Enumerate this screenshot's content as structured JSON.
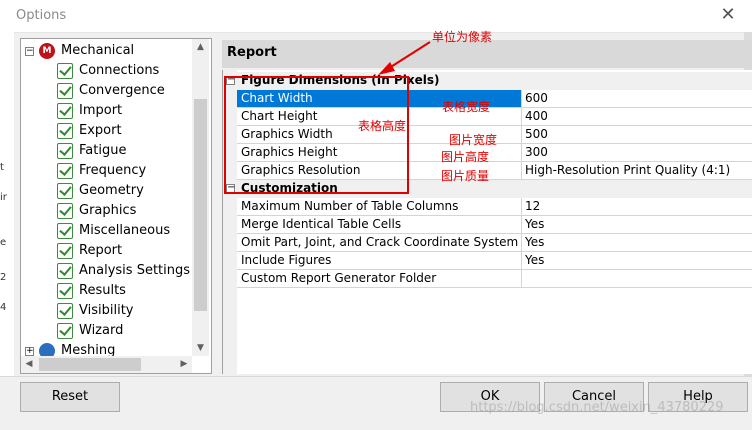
{
  "window": {
    "title": "Options",
    "close_glyph": "✕"
  },
  "tree": {
    "root": {
      "label": "Mechanical",
      "logo_letter": "M",
      "expander": "−"
    },
    "children": [
      {
        "label": "Connections"
      },
      {
        "label": "Convergence"
      },
      {
        "label": "Import"
      },
      {
        "label": "Export"
      },
      {
        "label": "Fatigue"
      },
      {
        "label": "Frequency"
      },
      {
        "label": "Geometry"
      },
      {
        "label": "Graphics"
      },
      {
        "label": "Miscellaneous"
      },
      {
        "label": "Report"
      },
      {
        "label": "Analysis Settings ar"
      },
      {
        "label": "Results"
      },
      {
        "label": "Visibility"
      },
      {
        "label": "Wizard"
      }
    ],
    "next_root": {
      "label": "Meshing",
      "expander": "+"
    }
  },
  "panel": {
    "title": "Report",
    "sections": [
      {
        "name": "Figure Dimensions (In Pixels)",
        "rows": [
          {
            "name": "Chart Width",
            "value": "600",
            "selected": true
          },
          {
            "name": "Chart Height",
            "value": "400"
          },
          {
            "name": "Graphics Width",
            "value": "500"
          },
          {
            "name": "Graphics Height",
            "value": "300"
          },
          {
            "name": "Graphics Resolution",
            "value": "High-Resolution Print Quality (4:1)"
          }
        ]
      },
      {
        "name": "Customization",
        "rows": [
          {
            "name": "Maximum Number of Table Columns",
            "value": "12"
          },
          {
            "name": "Merge Identical Table Cells",
            "value": "Yes"
          },
          {
            "name": "Omit Part, Joint, and Crack Coordinate System Tables",
            "value": "Yes"
          },
          {
            "name": "Include Figures",
            "value": "Yes"
          },
          {
            "name": "Custom Report Generator Folder",
            "value": ""
          }
        ]
      }
    ]
  },
  "annotations": {
    "unit_note": "单位为像素",
    "chart_width": "表格宽度",
    "chart_height": "表格高度",
    "graphics_width": "图片宽度",
    "graphics_height": "图片高度",
    "graphics_resolution": "图片质量"
  },
  "buttons": {
    "reset": "Reset",
    "ok": "OK",
    "cancel": "Cancel",
    "help": "Help"
  },
  "watermark": "https://blog.csdn.net/weixin_43780229",
  "colors": {
    "selection": "#0078d7",
    "annotation": "#e00000",
    "check": "#2e8b2e"
  }
}
